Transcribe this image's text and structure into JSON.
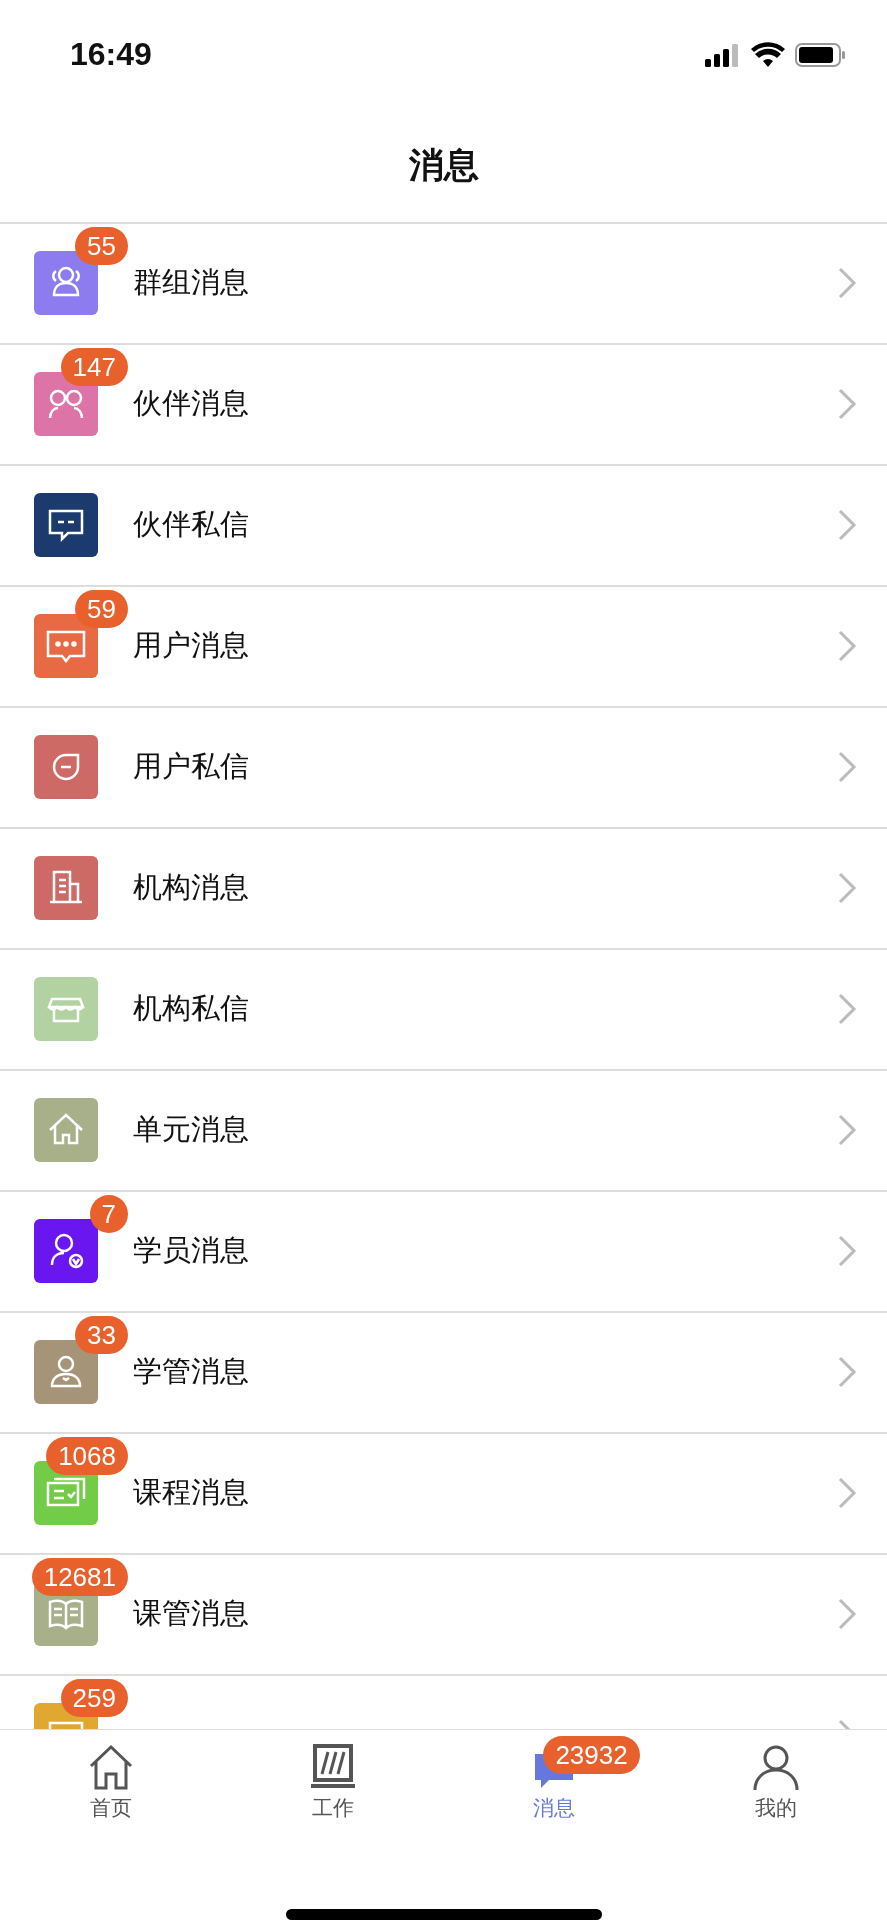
{
  "status_bar": {
    "time": "16:49"
  },
  "title": "消息",
  "items": [
    {
      "label": "群组消息",
      "badge": "55",
      "color": "#8c7cf0"
    },
    {
      "label": "伙伴消息",
      "badge": "147",
      "color": "#dc74a8"
    },
    {
      "label": "伙伴私信",
      "color": "#1b3a6e"
    },
    {
      "label": "用户消息",
      "badge": "59",
      "color": "#e86a44"
    },
    {
      "label": "用户私信",
      "color": "#cd6a66"
    },
    {
      "label": "机构消息",
      "color": "#cd6a66"
    },
    {
      "label": "机构私信",
      "color": "#b3d2a2"
    },
    {
      "label": "单元消息",
      "color": "#a8b08a"
    },
    {
      "label": "学员消息",
      "badge": "7",
      "color": "#6a16f0"
    },
    {
      "label": "学管消息",
      "badge": "33",
      "color": "#a69478"
    },
    {
      "label": "课程消息",
      "badge": "1068",
      "color": "#72cc48"
    },
    {
      "label": "课管消息",
      "badge": "12681",
      "color": "#a8b08a"
    },
    {
      "badge": "259",
      "color": "#e0a830"
    }
  ],
  "tab_bar": [
    {
      "label": "首页",
      "selected": false
    },
    {
      "label": "工作",
      "selected": false
    },
    {
      "label": "消息",
      "selected": true,
      "badge": "23932"
    },
    {
      "label": "我的",
      "selected": false
    }
  ]
}
